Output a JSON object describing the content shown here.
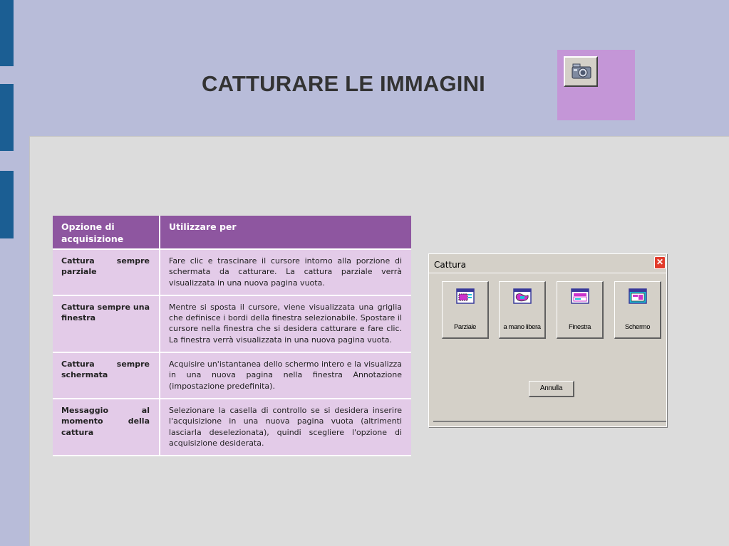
{
  "slide": {
    "title": "CATTURARE LE IMMAGINI",
    "colors": {
      "background": "#b8bcd9",
      "side_bars": "#1b5e93",
      "icon_box": "#c496d7",
      "content": "#dcdcdc"
    },
    "icon": "camera-icon"
  },
  "table": {
    "headers": [
      "Opzione di acquisizione",
      "Utilizzare per"
    ],
    "rows": [
      {
        "option": "Cattura sempre parziale",
        "use": "Fare clic e trascinare il cursore intorno alla porzione di schermata da catturare. La cattura parziale verrà visualizzata in una nuova pagina vuota."
      },
      {
        "option": "Cattura sempre una finestra",
        "use": "Mentre si sposta il cursore, viene visualizzata una griglia che definisce i bordi della finestra selezionabile. Spostare il cursore nella finestra che si desidera catturare e fare clic. La finestra verrà visualizzata in una nuova pagina vuota."
      },
      {
        "option": "Cattura sempre schermata",
        "use": "Acquisire un'istantanea dello schermo intero e la visualizza in una nuova pagina nella finestra Annotazione (impostazione predefinita)."
      },
      {
        "option": "Messaggio al momento della cattura",
        "use": "Selezionare la casella di controllo se si desidera inserire l'acquisizione in una nuova pagina vuota (altrimenti lasciarla deselezionata), quindi scegliere l'opzione di acquisizione desiderata."
      }
    ],
    "colors": {
      "header": "#8e56a0",
      "cell": "#e3cbe8"
    }
  },
  "dialog": {
    "title": "Cattura",
    "close": "✕",
    "buttons": [
      {
        "label": "Parziale",
        "icon": "partial-capture-icon"
      },
      {
        "label": "a mano libera",
        "icon": "freehand-capture-icon"
      },
      {
        "label": "Finestra",
        "icon": "window-capture-icon"
      },
      {
        "label": "Schermo",
        "icon": "screen-capture-icon"
      }
    ],
    "cancel": "Annulla"
  }
}
